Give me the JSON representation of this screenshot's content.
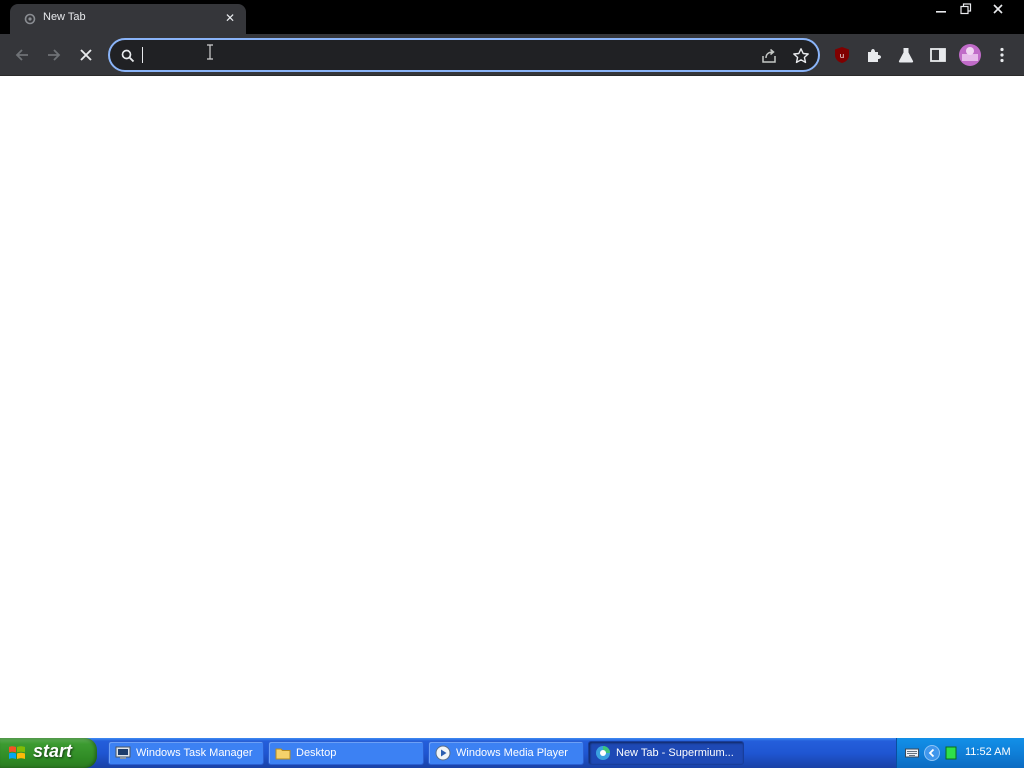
{
  "browser": {
    "tab": {
      "title": "New Tab",
      "close_symbol": "✕"
    },
    "omnibox": {
      "value": "",
      "placeholder": ""
    },
    "colors": {
      "accent": "#8ab4f8",
      "chrome_bg": "#35363a",
      "titlebar_bg": "#000000"
    }
  },
  "taskbar": {
    "start_label": "start",
    "tasks": [
      {
        "label": "Windows Task Manager",
        "icon": "task-manager-icon",
        "active": false
      },
      {
        "label": "Desktop",
        "icon": "folder-icon",
        "active": false
      },
      {
        "label": "Windows Media Player",
        "icon": "media-player-icon",
        "active": false
      },
      {
        "label": "New Tab - Supermium...",
        "icon": "supermium-icon",
        "active": true
      }
    ],
    "clock": "11:52 AM"
  }
}
